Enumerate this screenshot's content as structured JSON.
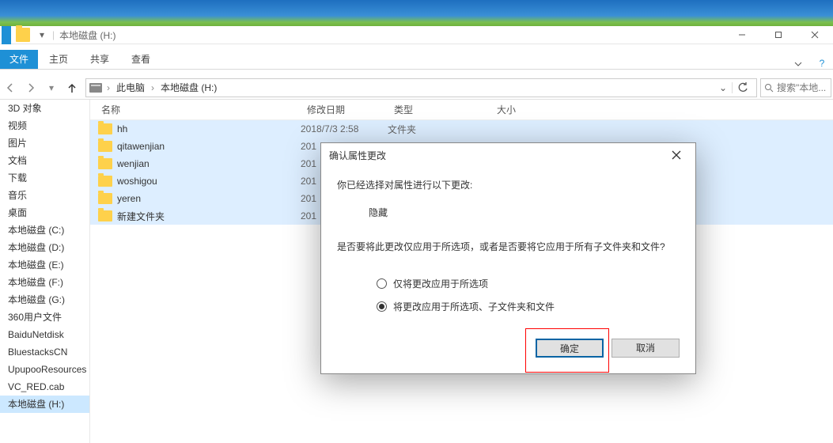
{
  "window": {
    "title": "本地磁盘 (H:)",
    "min_tip": "Minimize",
    "max_tip": "Maximize",
    "close_tip": "Close"
  },
  "ribbon": {
    "file": "文件",
    "tabs": [
      "主页",
      "共享",
      "查看"
    ]
  },
  "breadcrumb": {
    "segments": [
      "此电脑",
      "本地磁盘 (H:)"
    ],
    "refresh_icon": "refresh",
    "search_placeholder": "搜索\"本地..."
  },
  "tree": {
    "items": [
      "3D 对象",
      "视频",
      "图片",
      "文档",
      "下载",
      "音乐",
      "桌面",
      "本地磁盘 (C:)",
      "本地磁盘 (D:)",
      "本地磁盘 (E:)",
      "本地磁盘 (F:)",
      "本地磁盘 (G:)",
      "360用户文件",
      "BaiduNetdisk",
      "BluestacksCN",
      "UpupooResources",
      "VC_RED.cab",
      "本地磁盘 (H:)"
    ],
    "selected_index": 17
  },
  "columns": {
    "name": "名称",
    "date": "修改日期",
    "type": "类型",
    "size": "大小"
  },
  "rows": [
    {
      "name": "hh",
      "date": "2018/7/3 2:58",
      "type": "文件夹"
    },
    {
      "name": "qitawenjian",
      "date": "201",
      "type": ""
    },
    {
      "name": "wenjian",
      "date": "201",
      "type": ""
    },
    {
      "name": "woshigou",
      "date": "201",
      "type": ""
    },
    {
      "name": "yeren",
      "date": "201",
      "type": ""
    },
    {
      "name": "新建文件夹",
      "date": "201",
      "type": ""
    }
  ],
  "dialog": {
    "title": "确认属性更改",
    "prompt1": "你已经选择对属性进行以下更改:",
    "attr": "隐藏",
    "prompt2": "是否要将此更改仅应用于所选项，或者是否要将它应用于所有子文件夹和文件?",
    "radio1": "仅将更改应用于所选项",
    "radio2": "将更改应用于所选项、子文件夹和文件",
    "selected_radio": 2,
    "ok": "确定",
    "cancel": "取消"
  }
}
